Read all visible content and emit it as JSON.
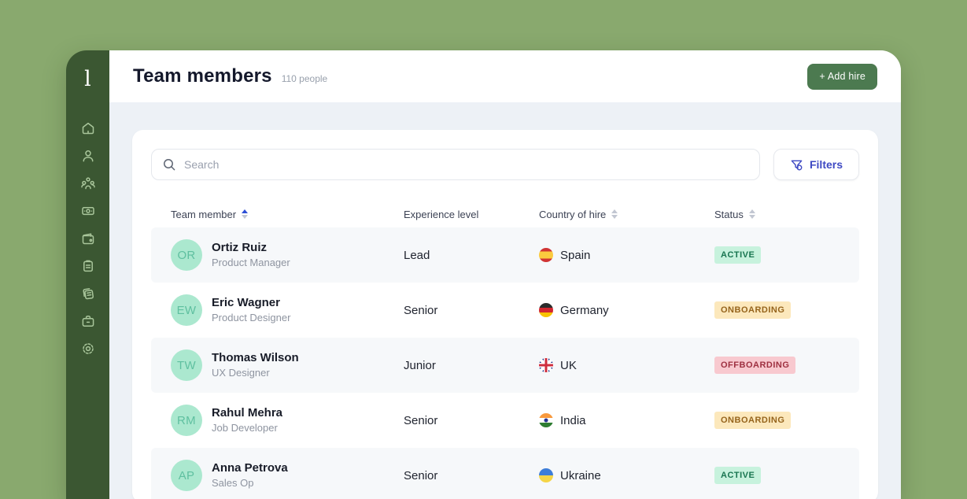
{
  "app": {
    "logo_letter": "l"
  },
  "sidebar": {
    "icons": [
      "home-icon",
      "profile-icon",
      "team-icon",
      "payments-icon",
      "wallet-icon",
      "tasks-icon",
      "documents-icon",
      "jobs-icon",
      "settings-icon"
    ]
  },
  "header": {
    "title": "Team members",
    "subtitle": "110 people",
    "add_button_label": "+ Add hire"
  },
  "toolbar": {
    "search_placeholder": "Search",
    "filters_label": "Filters",
    "filters_icon": "funnel-icon",
    "search_icon": "search-icon"
  },
  "table": {
    "columns": [
      {
        "label": "Team member",
        "sort": "asc"
      },
      {
        "label": "Experience level",
        "sort": null
      },
      {
        "label": "Country of hire",
        "sort": "none"
      },
      {
        "label": "Status",
        "sort": "none"
      }
    ],
    "rows": [
      {
        "initials": "OR",
        "name": "Ortiz Ruiz",
        "role": "Product Manager",
        "experience": "Lead",
        "flag": "spain",
        "country": "Spain",
        "status": "ACTIVE",
        "status_type": "active"
      },
      {
        "initials": "EW",
        "name": "Eric Wagner",
        "role": "Product Designer",
        "experience": "Senior",
        "flag": "germany",
        "country": "Germany",
        "status": "ONBOARDING",
        "status_type": "onboarding"
      },
      {
        "initials": "TW",
        "name": "Thomas Wilson",
        "role": "UX Designer",
        "experience": "Junior",
        "flag": "uk",
        "country": "UK",
        "status": "OFFBOARDING",
        "status_type": "offboarding"
      },
      {
        "initials": "RM",
        "name": "Rahul Mehra",
        "role": "Job Developer",
        "experience": "Senior",
        "flag": "india",
        "country": "India",
        "status": "ONBOARDING",
        "status_type": "onboarding"
      },
      {
        "initials": "AP",
        "name": "Anna Petrova",
        "role": "Sales Op",
        "experience": "Senior",
        "flag": "ukraine",
        "country": "Ukraine",
        "status": "ACTIVE",
        "status_type": "active"
      }
    ]
  },
  "colors": {
    "desktop_background": "#89a96e",
    "sidebar_background": "#3b5732",
    "sidebar_icon": "#a9c69b",
    "accent_green_button": "#4c7a50",
    "filters_accent": "#3e49c3",
    "avatar_background": "#abe8cf",
    "avatar_text": "#5fc0a0",
    "badge_active_bg": "#c7f2dd",
    "badge_active_text": "#187550",
    "badge_onboarding_bg": "#fce8bc",
    "badge_onboarding_text": "#96641c",
    "badge_offboarding_bg": "#f8c9cf",
    "badge_offboarding_text": "#9e3040",
    "sort_active_arrow": "#2d4fd6",
    "row_stripe": "#f6f8fa"
  }
}
